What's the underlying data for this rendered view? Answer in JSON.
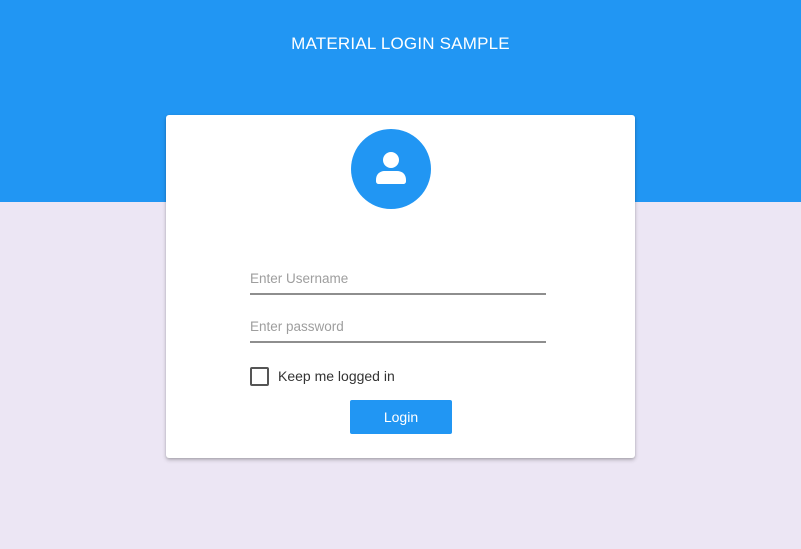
{
  "header": {
    "title": "MATERIAL LOGIN SAMPLE"
  },
  "colors": {
    "primary": "#2196f3",
    "page_background": "#ece6f4",
    "card_background": "#ffffff"
  },
  "login_card": {
    "avatar_icon": "user-icon",
    "username": {
      "value": "",
      "placeholder": "Enter Username"
    },
    "password": {
      "value": "",
      "placeholder": "Enter password"
    },
    "remember_me": {
      "label": "Keep me logged in",
      "checked": false
    },
    "login_label": "Login"
  }
}
